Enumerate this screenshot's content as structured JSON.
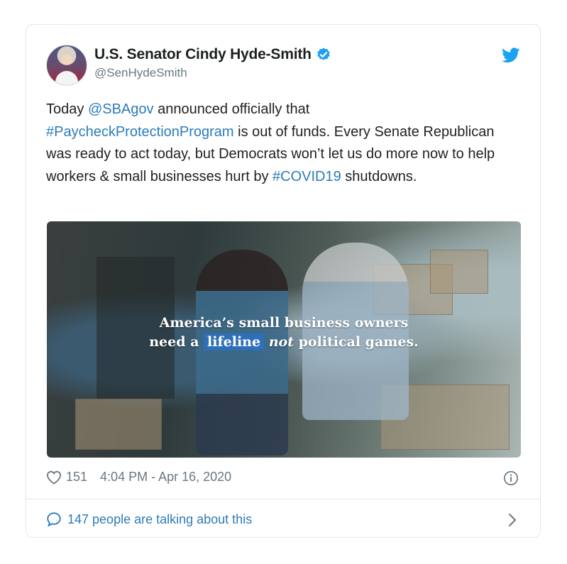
{
  "author": {
    "display_name": "U.S. Senator Cindy Hyde-Smith",
    "handle": "@SenHydeSmith",
    "verified": true
  },
  "tweet": {
    "segments": [
      {
        "text": "Today ",
        "link": false
      },
      {
        "text": "@SBAgov",
        "link": true
      },
      {
        "text": " announced officially that ",
        "link": false
      },
      {
        "text": "#PaycheckProtectionProgram",
        "link": true
      },
      {
        "text": " is out of funds. Every Senate Republican was ready to act today, but Democrats won’t let us do more now to help workers & small businesses hurt by ",
        "link": false
      },
      {
        "text": "#COVID19",
        "link": true
      },
      {
        "text": " shutdowns.",
        "link": false
      }
    ]
  },
  "media": {
    "overlay_line1": "America’s small business owners",
    "overlay_line2_a": "need a ",
    "overlay_line2_highlight": "lifeline",
    "overlay_line2_em": "not",
    "overlay_line2_b": " political games."
  },
  "meta": {
    "likes": "151",
    "timestamp": "4:04 PM - Apr 16, 2020"
  },
  "conversation": {
    "label": "147 people are talking about this"
  },
  "colors": {
    "link": "#2b7bb9",
    "verified": "#1da1f2",
    "twitter_bird": "#1da1f2",
    "highlight": "#2f6fb8"
  },
  "icons": [
    "verified-badge-icon",
    "twitter-bird-icon",
    "heart-icon",
    "info-icon",
    "speech-bubble-icon",
    "chevron-right-icon"
  ]
}
